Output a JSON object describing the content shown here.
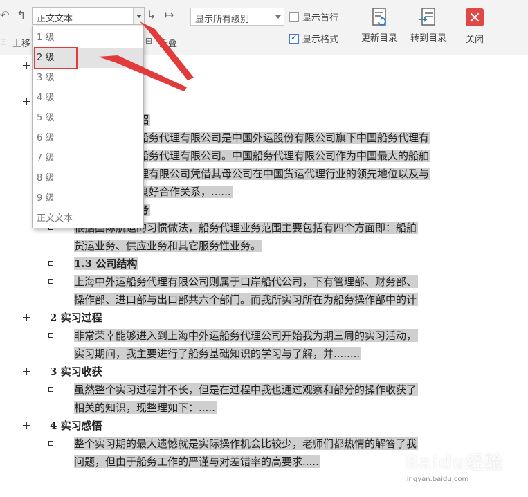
{
  "toolbar": {
    "style_select_value": "正文文本",
    "move_up_label": "上移",
    "collapse_label": "折叠",
    "level_select_value": "显示所有级别",
    "show_first_line_label": "显示首行",
    "show_format_label": "显示格式",
    "update_toc_label": "更新目录",
    "goto_toc_label": "转到目录",
    "close_label": "关闭",
    "show_first_line_checked": false,
    "show_format_checked": true
  },
  "dropdown": {
    "items": [
      "1 级",
      "2 级",
      "3 级",
      "4 级",
      "5 级",
      "6 级",
      "7 级",
      "8 级",
      "9 级",
      "正文文本"
    ],
    "selected_index": 1
  },
  "document": {
    "lines": [
      "绍",
      "船务代理有限公司是中国外运股份有限公司旗下中国船务代理有",
      "船务代理有限公司。中国船务代理有限公司作为中国最大的船舶",
      "理有限公司凭借其母公司在中国货运代理行业的领先地位以及与",
      "良好合作关系，......",
      "务",
      "根据国际航运的习惯做法，船务代理业务范围主要包括有四个方面即：船舶",
      "货运业务、供应业务和其它服务性业务。",
      "1.3 公司结构",
      "上海中外运船务代理有限公司则属于口岸船代公司，下有管理部、财务部、",
      "操作部、进口部与出口部共六个部门。而我所实习所在为船务操作部中的计",
      "2 实习过程",
      "非常荣幸能够进入到上海中外运船务代理公司开始我为期三周的实习活动，",
      "实习期间，我主要进行了船务基础知识的学习与了解，并........",
      "3 实习收获",
      "虽然整个实习过程并不长，但是在过程中我也通过观察和部分的操作收获了",
      "相关的知识，现整理如下：.....",
      "4 实习感悟",
      "整个实习期的最大遗憾就是实际操作机会比较少，老师们都热情的解答了我",
      "问题，但由于船务工作的严谨与对差错率的高要求....."
    ]
  },
  "watermark": {
    "main": "Baidu经验",
    "sub": "jingyan.baidu.com"
  },
  "colors": {
    "highlight": "#cfcfcf",
    "annotation_red": "#e23b3b",
    "close_red": "#e04848",
    "toolbar_bg": "#f3f3f3"
  }
}
